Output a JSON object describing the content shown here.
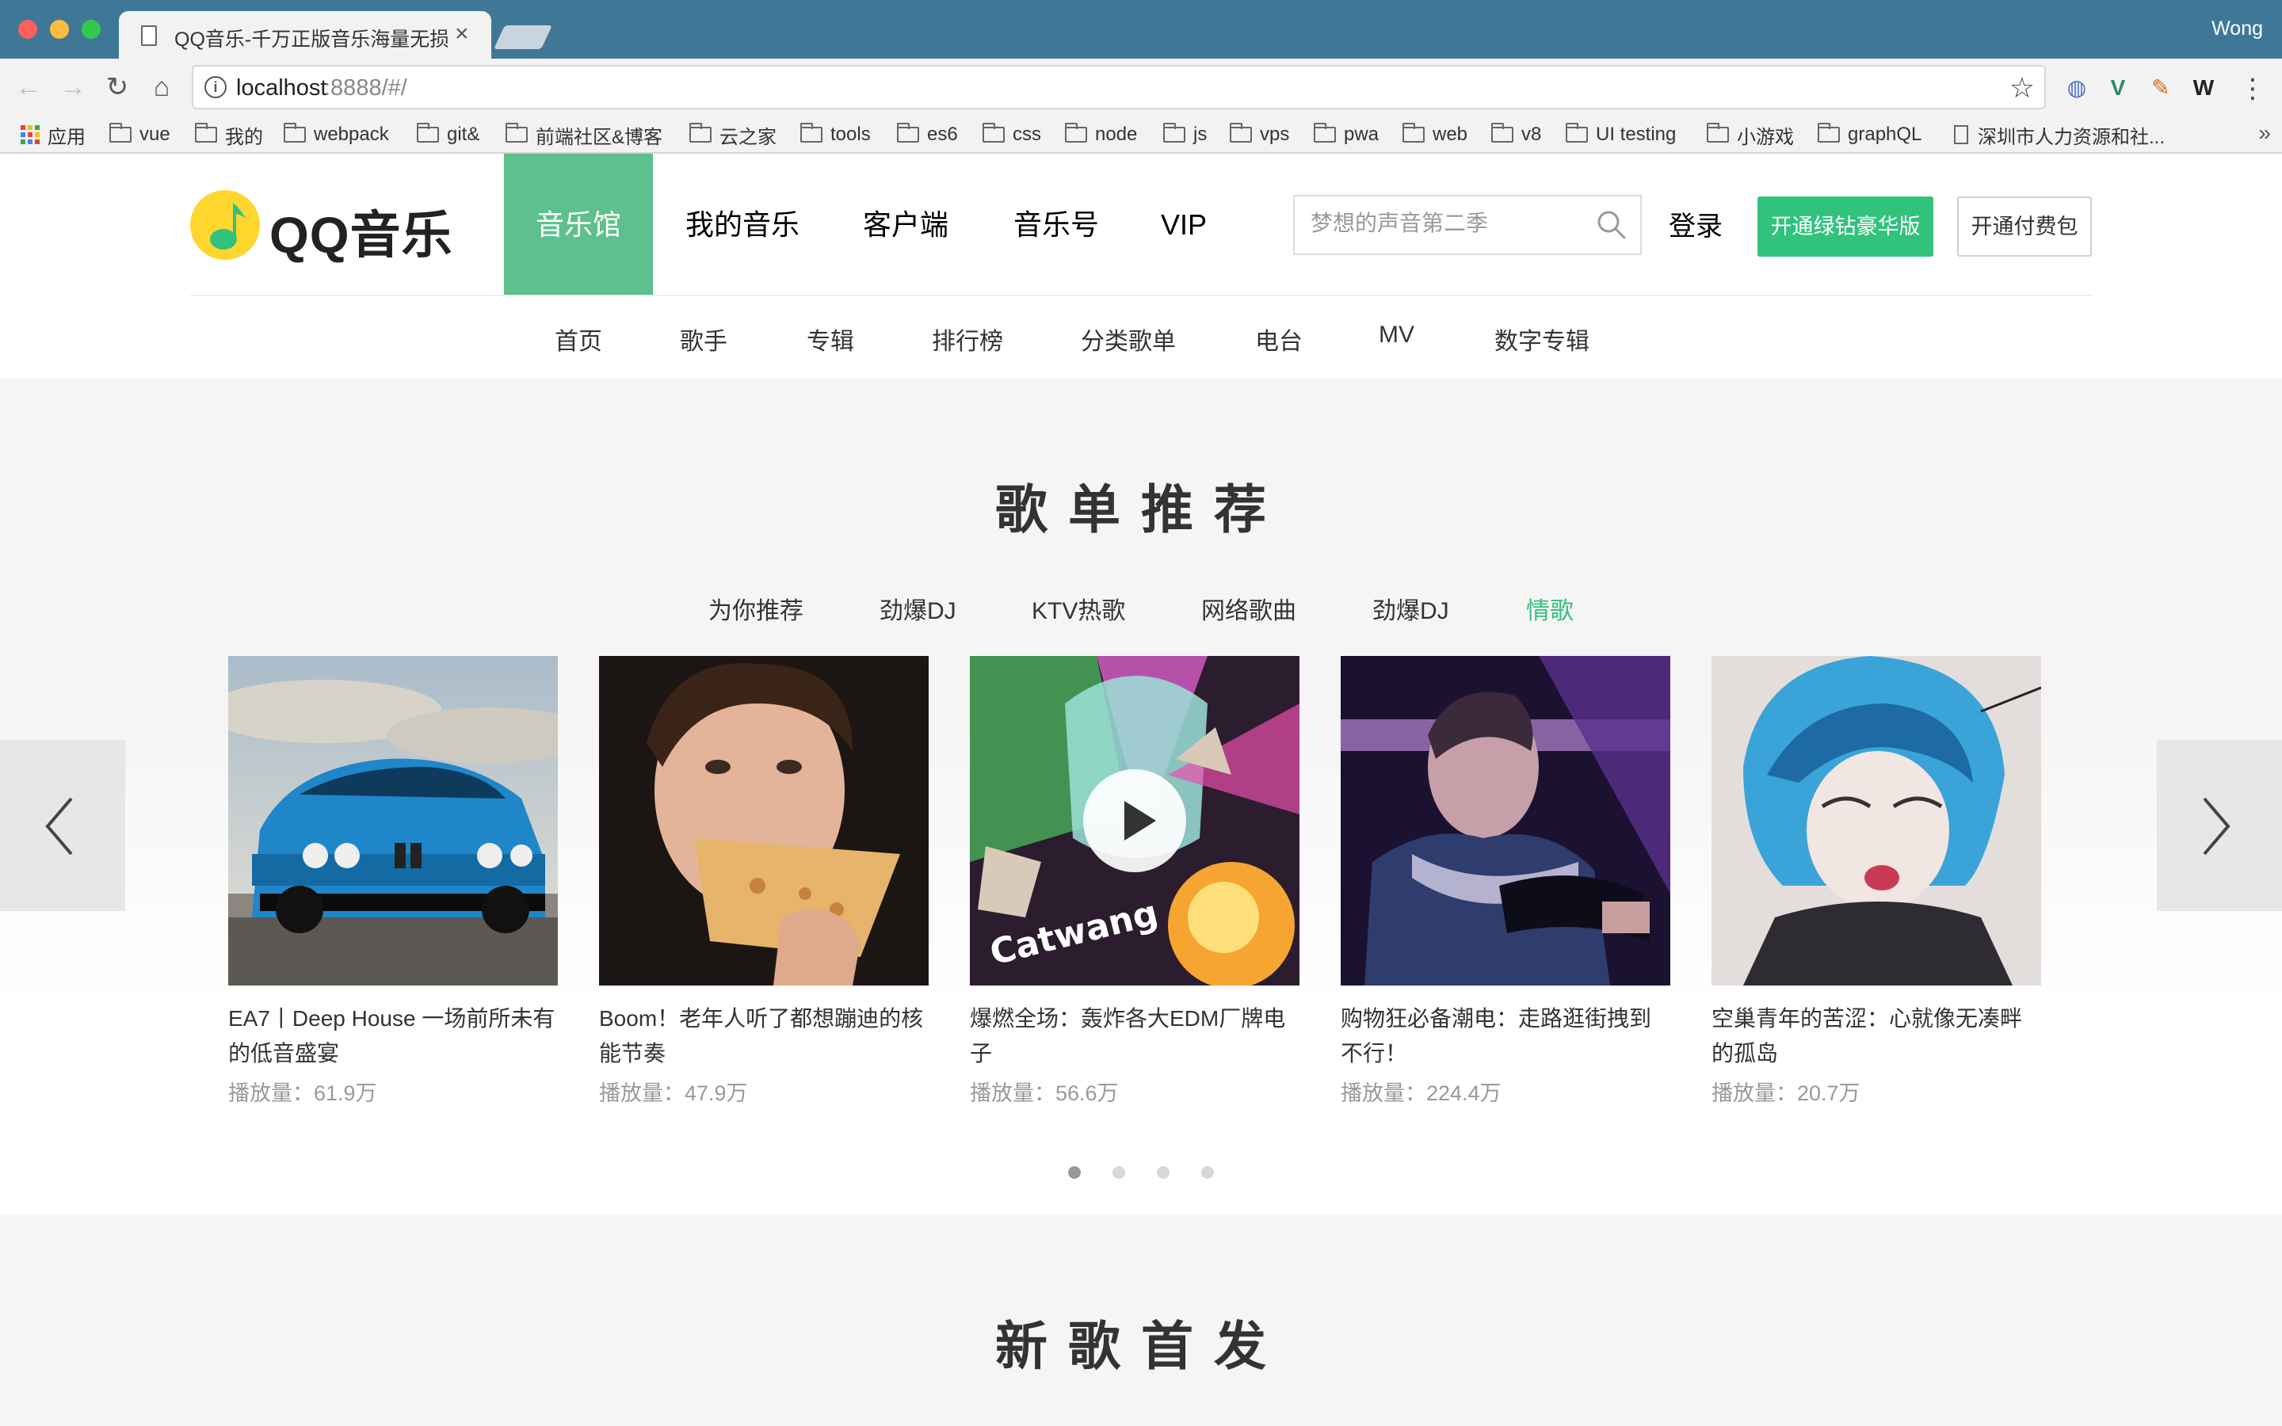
{
  "browser": {
    "tab_title": "QQ音乐-千万正版音乐海量无损",
    "tab_close": "×",
    "user": "Wong",
    "url_host": "localhost",
    "url_rest": ":8888/#/",
    "bookmarks": [
      "应用",
      "vue",
      "我的",
      "webpack",
      "git&",
      "前端社区&博客",
      "云之家",
      "tools",
      "es6",
      "css",
      "node",
      "js",
      "vps",
      "pwa",
      "web",
      "v8",
      "UI testing",
      "小游戏",
      "graphQL",
      "深圳市人力资源和社..."
    ],
    "more": "»"
  },
  "site": {
    "logo_text": "QQ音乐",
    "main_nav": [
      "音乐馆",
      "我的音乐",
      "客户端",
      "音乐号",
      "VIP"
    ],
    "search_placeholder": "梦想的声音第二季",
    "login": "登录",
    "btn_green": "开通绿钻豪华版",
    "btn_outline": "开通付费包",
    "sub_nav": [
      "首页",
      "歌手",
      "专辑",
      "排行榜",
      "分类歌单",
      "电台",
      "MV",
      "数字专辑"
    ]
  },
  "playlist_section": {
    "title": "歌单推荐",
    "tabs": [
      "为你推荐",
      "劲爆DJ",
      "KTV热歌",
      "网络歌曲",
      "劲爆DJ",
      "情歌"
    ],
    "active_tab": 5,
    "cards": [
      {
        "title": "EA7丨Deep House 一场前所未有的低音盛宴",
        "plays": "播放量：61.9万"
      },
      {
        "title": "Boom！老年人听了都想蹦迪的核能节奏",
        "plays": "播放量：47.9万"
      },
      {
        "title": "爆燃全场：轰炸各大EDM厂牌电子",
        "plays": "播放量：56.6万",
        "cover_text": "Catwang"
      },
      {
        "title": "购物狂必备潮电：走路逛街拽到不行！",
        "plays": "播放量：224.4万"
      },
      {
        "title": "空巢青年的苦涩：心就像无凑畔的孤岛",
        "plays": "播放量：20.7万"
      }
    ],
    "pagination_count": 4,
    "pagination_active": 0
  },
  "new_songs_section": {
    "title": "新歌首发"
  },
  "colors": {
    "brand_green": "#31c27c",
    "nav_active_bg": "#5ec08c",
    "titlebar": "#3f7896"
  }
}
